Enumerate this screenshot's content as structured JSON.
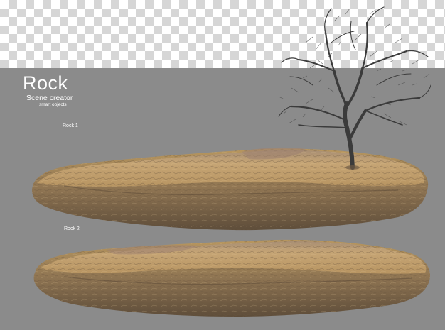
{
  "header": {
    "title": "Rock",
    "subtitle": "Scene creator",
    "tagline": "smart objects"
  },
  "labels": {
    "rock1": "Rock 1",
    "rock2": "Rock 2"
  },
  "colors": {
    "background_grey": "#8b8b8b",
    "checker_light": "#ffffff",
    "checker_dark": "#d6d6d6",
    "rock_top": "#c8a774",
    "rock_side": "#8d7250",
    "tree_branch": "#3b3b3b"
  }
}
